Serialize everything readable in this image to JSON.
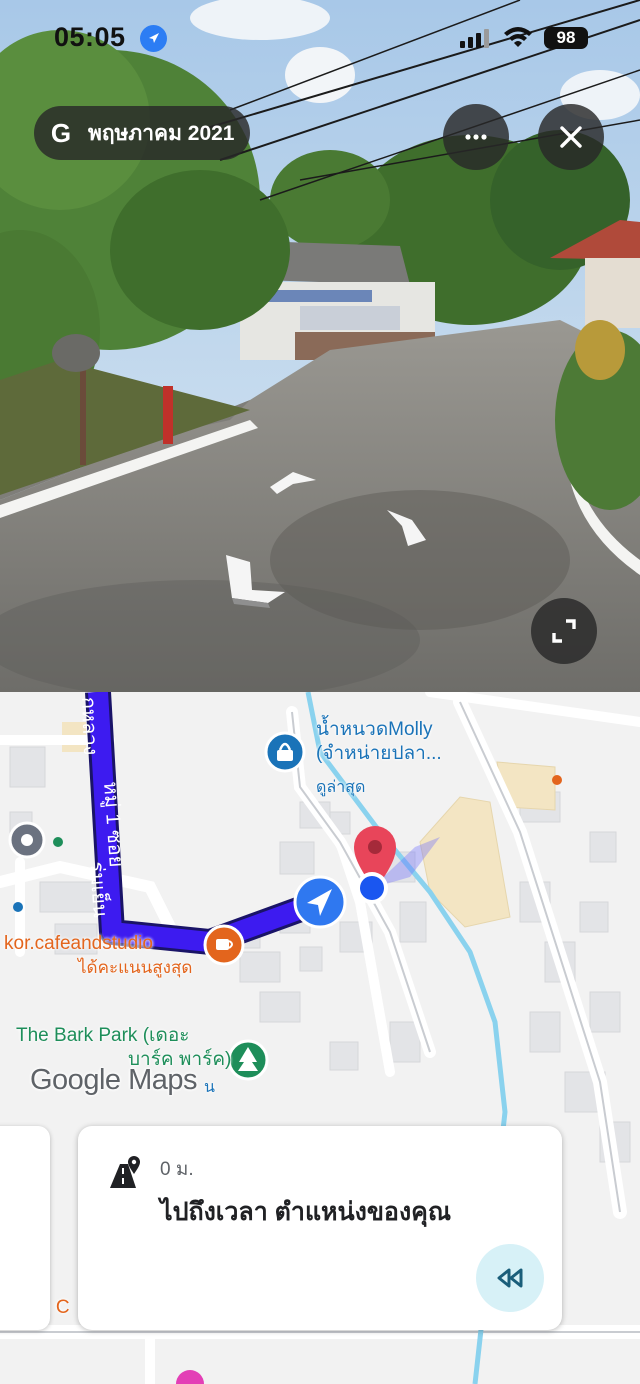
{
  "status_bar": {
    "time": "05:05",
    "battery": "98"
  },
  "street_view": {
    "date_chip": {
      "logo": "G",
      "date": "พฤษภาคม 2021"
    },
    "icons": [
      "location-arrow-icon",
      "signal-icon",
      "wifi-icon",
      "more-icon",
      "close-icon",
      "expand-icon",
      "nav-chevron-icon"
    ]
  },
  "map": {
    "places": {
      "massage": {
        "name_line1": "น้ำหนวดMolly",
        "name_line2": "(จำหน่ายปลา...",
        "status": "ดูล่าสุด"
      },
      "cafe": {
        "name": "kor.cafeandstudio",
        "status": "ได้คะแนนสูงสุด"
      },
      "park": {
        "name_line1": "The Bark Park (เดอะ",
        "name_line2": "บาร์ค พาร์ค)",
        "suffix": "น"
      }
    },
    "road_label": "หมู่ 1 ซอย",
    "watermark": "Google Maps",
    "partial_label": "n C"
  },
  "nav_card": {
    "distance": "0 ม.",
    "instruction": "ไปถึงเวลา ตำแหน่งของคุณ"
  },
  "colors": {
    "route": "#3d1bf0",
    "user_dot": "#1a56f0",
    "pin": "#e8455a",
    "nav_accent": "#1a73b8",
    "rewind_bg": "#d7f1f7"
  }
}
